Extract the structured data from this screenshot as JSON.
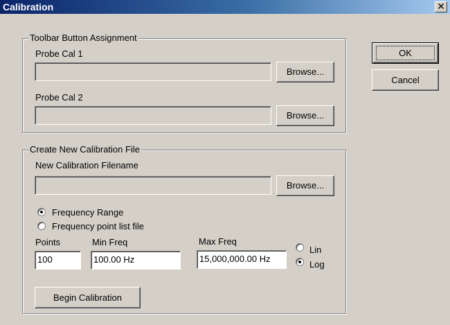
{
  "window": {
    "title": "Calibration",
    "close_glyph": "✕"
  },
  "buttons": {
    "ok": "OK",
    "cancel": "Cancel"
  },
  "toolbar_group": {
    "legend": "Toolbar Button Assignment",
    "probe_cal_1_label": "Probe Cal 1",
    "probe_cal_1_value": "",
    "probe_cal_2_label": "Probe Cal 2",
    "probe_cal_2_value": "",
    "browse_label": "Browse..."
  },
  "create_group": {
    "legend": "Create New Calibration File",
    "filename_label": "New Calibration Filename",
    "filename_value": "",
    "browse_label": "Browse...",
    "radio_frequency_range": "Frequency Range",
    "radio_frequency_point_list": "Frequency point list file",
    "selected_mode": "Frequency Range",
    "points_label": "Points",
    "points_value": "100",
    "min_freq_label": "Min Freq",
    "min_freq_value": "100.00 Hz",
    "max_freq_label": "Max Freq",
    "max_freq_value": "15,000,000.00 Hz",
    "scale_lin": "Lin",
    "scale_log": "Log",
    "selected_scale": "Log",
    "begin_label": "Begin Calibration"
  }
}
